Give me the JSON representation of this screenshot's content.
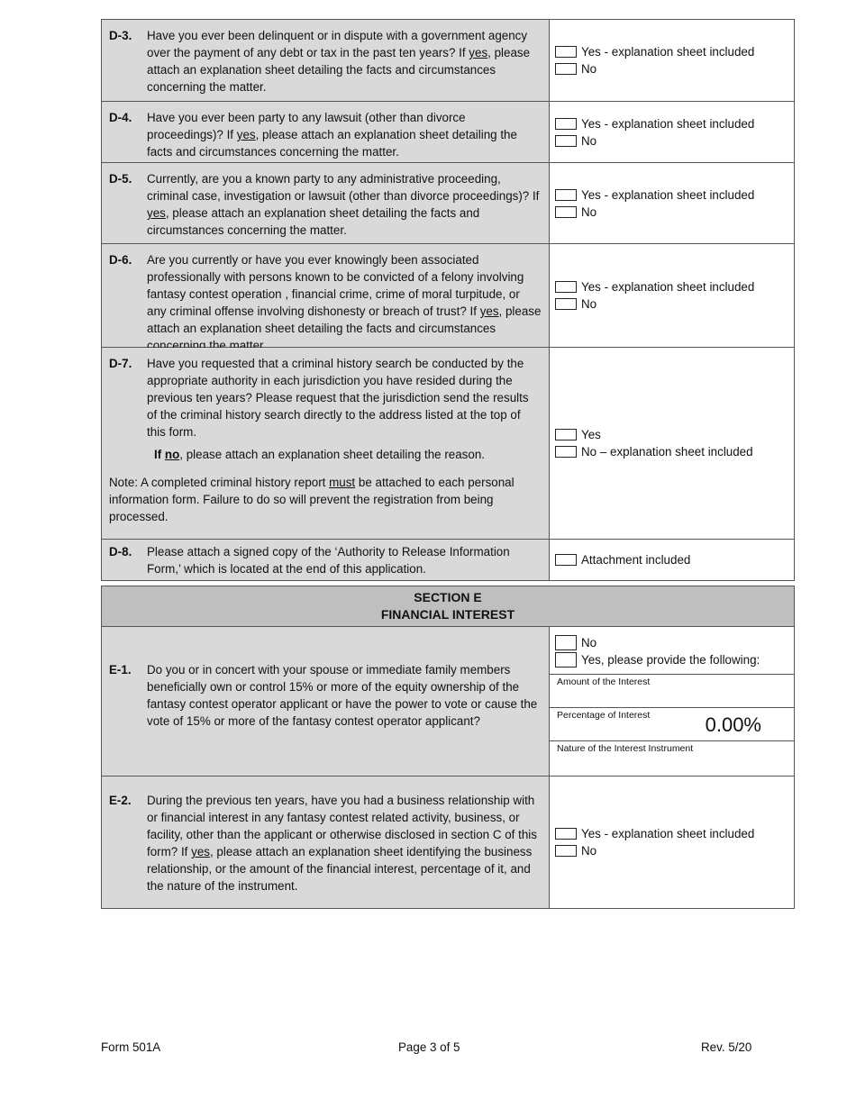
{
  "sectionD": {
    "questions": [
      {
        "num": "D-3.",
        "text_pre": "Have you ever been delinquent or in dispute with a government agency over the payment of any debt or tax in the past ten years?  If ",
        "text_u": "yes",
        "text_post": ", please attach an explanation sheet detailing the facts and circumstances concerning the matter.",
        "options": [
          "Yes - explanation sheet included",
          "No"
        ]
      },
      {
        "num": "D-4.",
        "text_pre": "Have you ever been party to any lawsuit (other than divorce proceedings)?  If ",
        "text_u": "yes",
        "text_post": ", please attach an explanation sheet detailing the facts and circumstances concerning the matter.",
        "options": [
          "Yes - explanation sheet included",
          "No"
        ]
      },
      {
        "num": "D-5.",
        "text_pre": "Currently, are you a known party to any administrative proceeding, criminal case, investigation or lawsuit (other than divorce proceedings)?  If ",
        "text_u": "yes",
        "text_post": ", please attach an explanation sheet detailing the facts and circumstances concerning the matter.",
        "options": [
          "Yes - explanation sheet included",
          "No"
        ]
      },
      {
        "num": "D-6.",
        "text_pre": "Are you currently or have you ever knowingly been associated professionally with persons known to be convicted of a felony involving fantasy contest operation , financial crime, crime of moral turpitude, or any criminal offense involving dishonesty or breach of trust?  If ",
        "text_u": "yes",
        "text_post": ", please attach an explanation sheet detailing the facts and circumstances concerning the matter.",
        "options": [
          "Yes - explanation sheet included",
          "No"
        ]
      },
      {
        "num": "D-7.",
        "text": "Have you requested that a criminal history search be conducted by the appropriate authority in each jurisdiction you have resided during the previous ten years?  Please request that the jurisdiction send the results of the criminal history search directly to the address listed at the top of this form.",
        "sub_if": "If ",
        "sub_u": "no",
        "sub_post": ", please attach an explanation sheet detailing the reason.",
        "note_pre": "Note:  A completed criminal history report ",
        "note_u": "must",
        "note_post": " be attached to each personal information form.  Failure to do so will prevent the registration from being processed.",
        "options": [
          "Yes",
          "No – explanation sheet included"
        ]
      },
      {
        "num": "D-8.",
        "text": "Please attach a signed copy of the ‘Authority to Release Information Form,’ which is located at the end of this application.",
        "options": [
          "Attachment included"
        ]
      }
    ]
  },
  "sectionE": {
    "title": "SECTION E",
    "subtitle": "FINANCIAL INTEREST",
    "e1": {
      "num": "E-1.",
      "text": "Do you or in concert with your spouse or immediate family members beneficially own or control 15% or more of the equity ownership of the fantasy contest operator applicant or have the power to vote or cause the vote of 15% or more of the fantasy contest operator applicant?",
      "options": [
        "No",
        "Yes, please provide the following:"
      ],
      "fields": {
        "amount_label": "Amount of the Interest",
        "amount_value": "",
        "percentage_label": "Percentage of Interest",
        "percentage_value": "0.00%",
        "nature_label": "Nature of the Interest Instrument",
        "nature_value": ""
      }
    },
    "e2": {
      "num": "E-2.",
      "text_pre": "During the previous ten years, have you had a business relationship with or financial interest in any fantasy contest related activity, business, or facility, other than the applicant or otherwise disclosed in section C of this form?  If ",
      "text_u": "yes",
      "text_post": ", please attach an explanation sheet identifying the business relationship, or the amount of the financial interest, percentage of it, and the nature of the instrument.",
      "options": [
        "Yes - explanation sheet included",
        "No"
      ]
    }
  },
  "footer": {
    "form": "Form 501A",
    "page": "Page 3 of 5",
    "rev": "Rev. 5/20"
  }
}
